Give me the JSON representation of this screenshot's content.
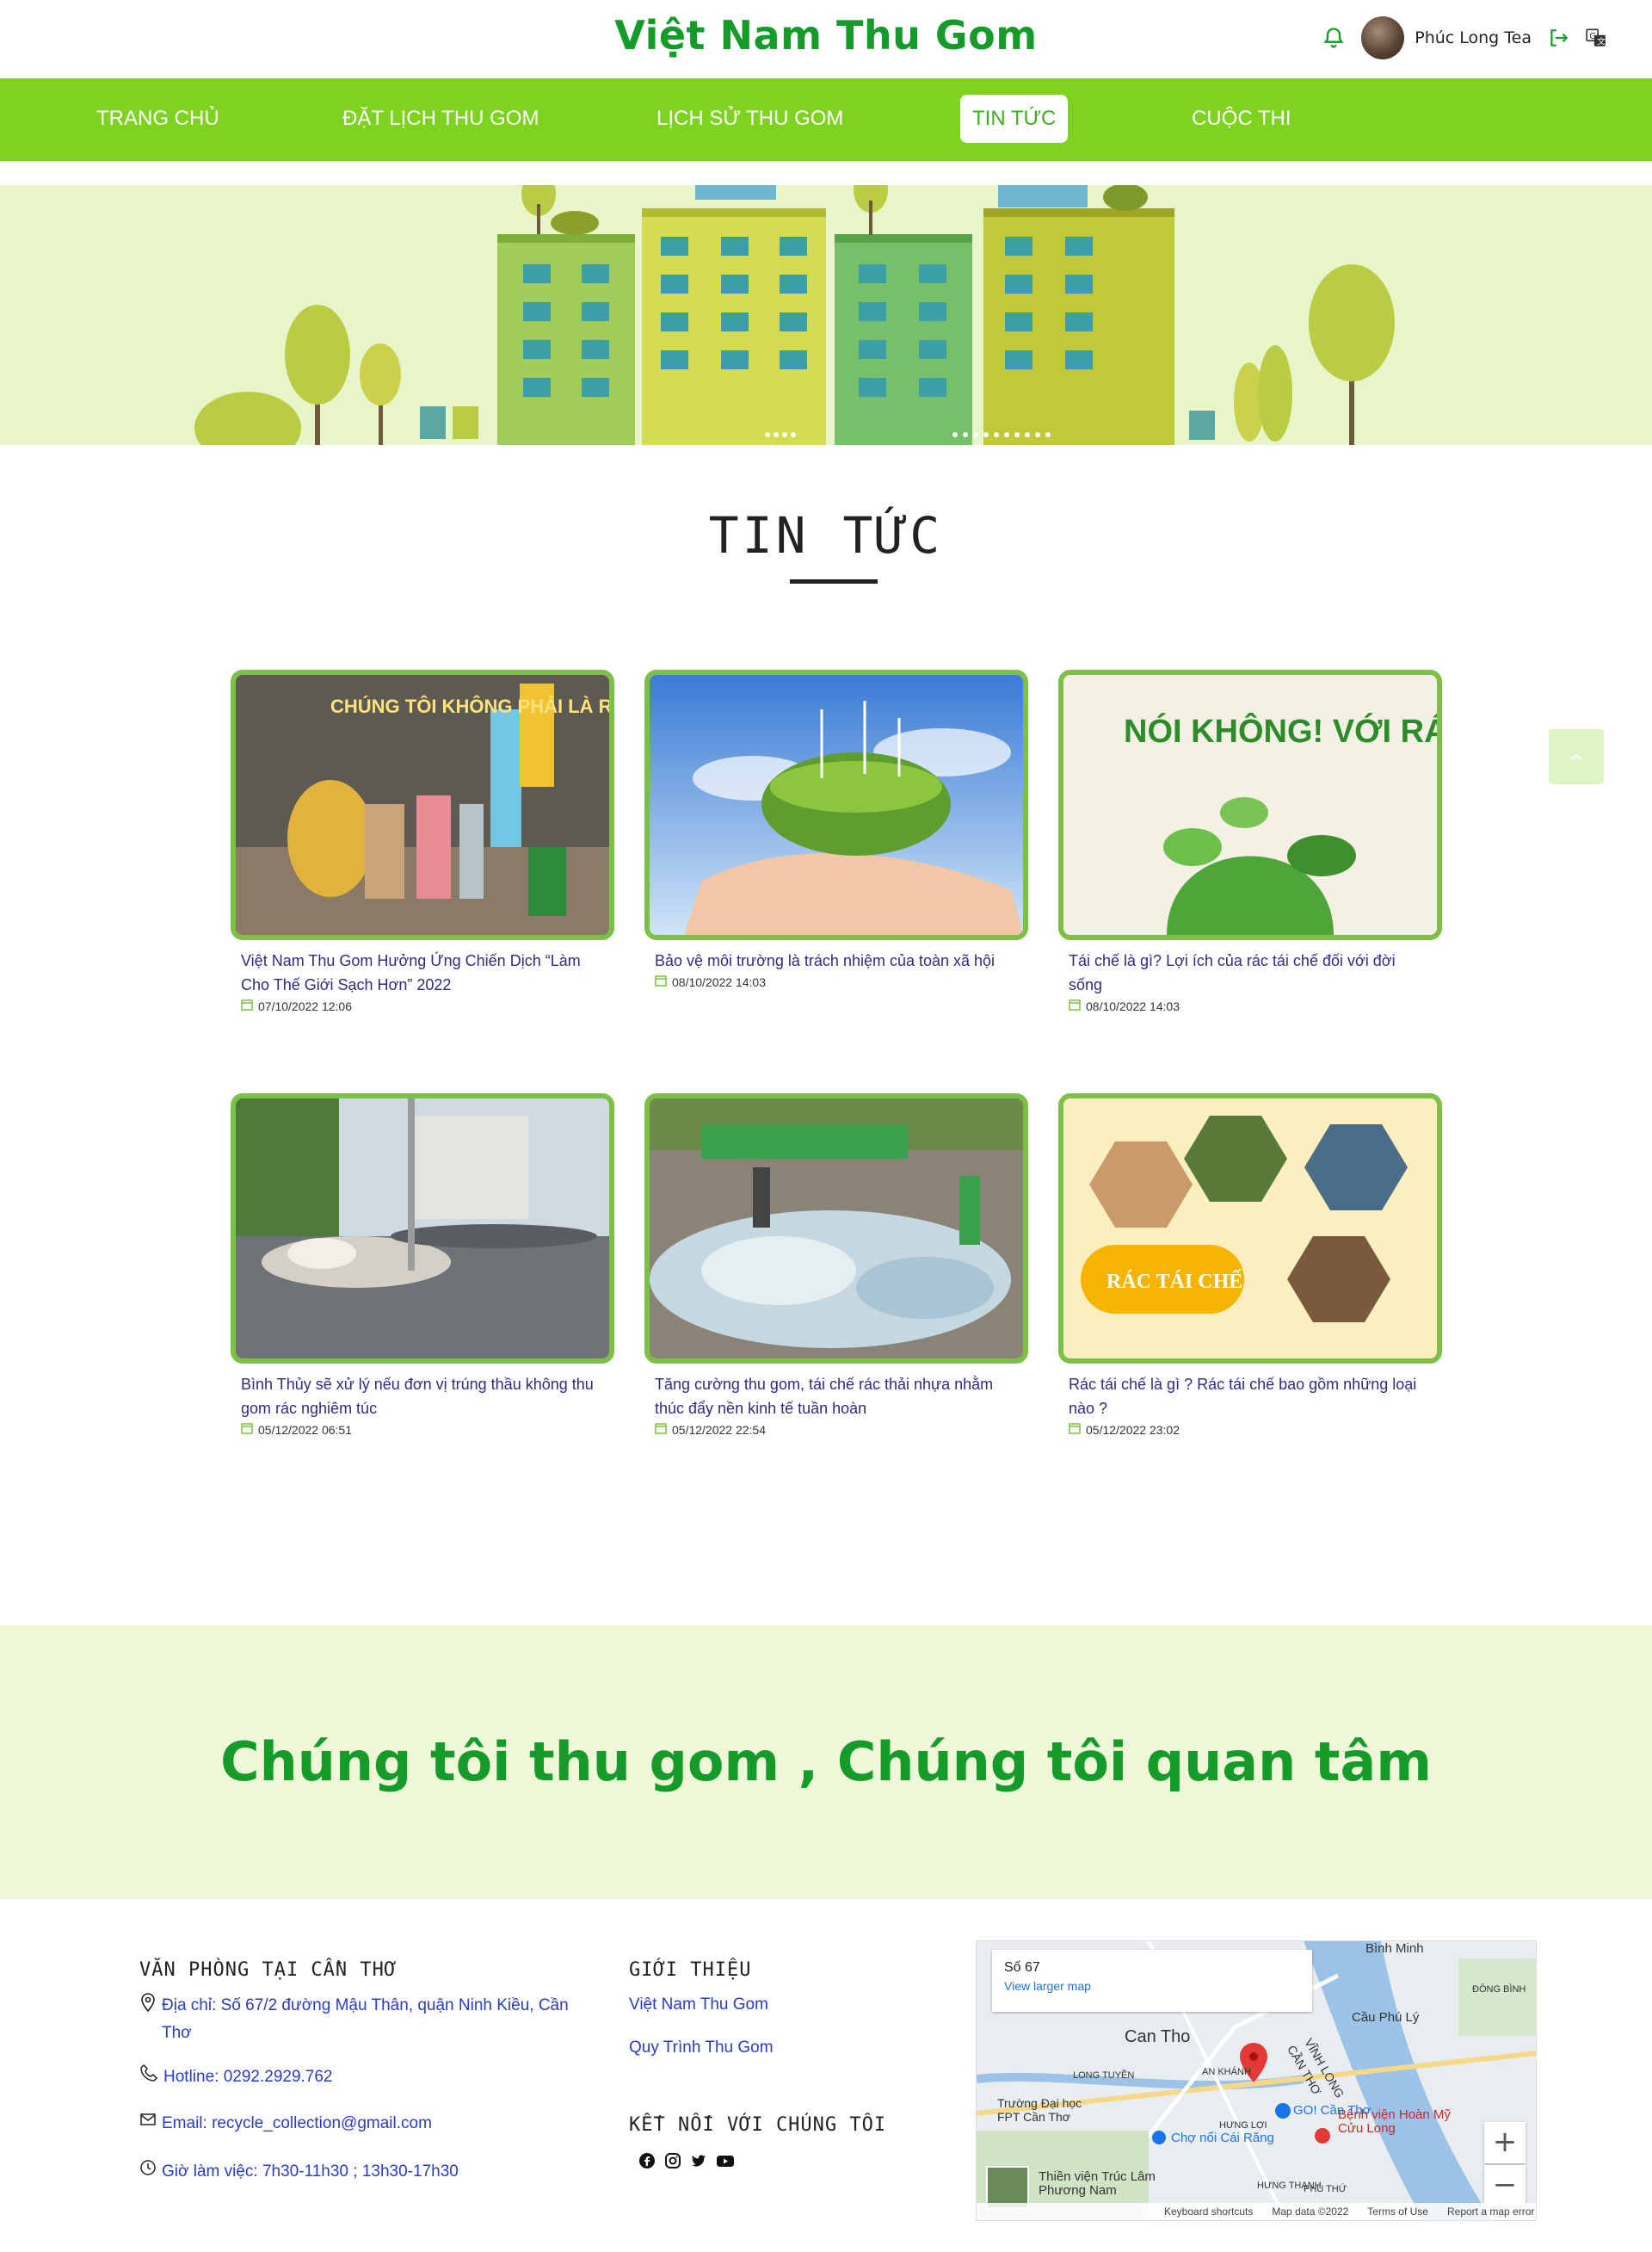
{
  "header": {
    "brand": "Việt Nam Thu Gom",
    "username": "Phúc Long Tea"
  },
  "nav": {
    "items": [
      {
        "label": "TRANG CHỦ",
        "active": false
      },
      {
        "label": "ĐẶT LỊCH THU GOM",
        "active": false
      },
      {
        "label": "LỊCH SỬ THU GOM",
        "active": false
      },
      {
        "label": "TIN TỨC",
        "active": true
      },
      {
        "label": "CUỘC THI",
        "active": false
      }
    ]
  },
  "page": {
    "title": "TIN TỨC"
  },
  "news": [
    {
      "title": "Việt Nam Thu Gom Hưởng Ứng Chiến Dịch “Làm Cho Thế Giới Sạch Hơn” 2022",
      "date": "07/10/2022 12:06",
      "image_text": "CHÚNG TÔI KHÔNG PHẢI LÀ RÁC"
    },
    {
      "title": "Bảo vệ môi trường là trách nhiệm của toàn xã hội",
      "date": "08/10/2022 14:03",
      "image_text": ""
    },
    {
      "title": "Tái chế là gì? Lợi ích của rác tái chế đối với đời sống",
      "date": "08/10/2022 14:03",
      "image_text": "NÓI KHÔNG! VỚI RÁC THẢI NHỰA"
    },
    {
      "title": "Bình Thủy sẽ xử lý nếu đơn vị trúng thầu không thu gom rác nghiêm túc",
      "date": "05/12/2022 06:51",
      "image_text": ""
    },
    {
      "title": "Tăng cường thu gom, tái chế rác thải nhựa nhằm thúc đẩy nền kinh tế tuần hoàn",
      "date": "05/12/2022 22:54",
      "image_text": ""
    },
    {
      "title": "Rác tái chế là gì ? Rác tái chế bao gồm những loại nào ?",
      "date": "05/12/2022 23:02",
      "image_text": "RÁC TÁI CHẾ"
    }
  ],
  "slogan": "Chúng tôi thu gom , Chúng tôi quan tâm",
  "footer": {
    "office_heading": "VĂN PHÒNG TẠI CẦN THƠ",
    "address": "Địa chỉ: Số 67/2 đường Mậu Thân, quận Ninh Kiều, Cần Thơ",
    "hotline": "Hotline: 0292.2929.762",
    "email": "Email: recycle_collection@gmail.com",
    "hours": "Giờ làm việc: 7h30-11h30 ; 13h30-17h30",
    "intro_heading": "GIỚI THIỆU",
    "intro_links": [
      "Việt Nam Thu Gom",
      "Quy Trình Thu Gom"
    ],
    "connect_heading": "KẾT NỐI VỚI CHÚNG TÔI",
    "socials": [
      "facebook-icon",
      "instagram-icon",
      "twitter-icon",
      "youtube-icon"
    ]
  },
  "map": {
    "place": "Số 67",
    "view_larger": "View larger map",
    "labels": [
      "Can Tho",
      "Bình Minh",
      "Cầu Phú Lý",
      "Bệnh viện Hoàn Mỹ Cửu Long",
      "Chợ nổi Cái Răng",
      "GO! Cần Thơ",
      "Trường Đại học FPT Cần Thơ",
      "VĨNH LONG",
      "CẦN THƠ",
      "ĐÔNG BÌNH",
      "LONG TUYỀN",
      "AN KHÁNH",
      "HƯNG LỢI",
      "HƯNG THẠNH",
      "PHÚ THỨ",
      "Thiền viện Trúc Lâm Phương Nam"
    ],
    "footer_items": [
      "Keyboard shortcuts",
      "Map data ©2022",
      "Terms of Use",
      "Report a map error"
    ],
    "zoom_in": "+",
    "zoom_out": "−"
  },
  "colors": {
    "brand_green": "#149b2a",
    "nav_green": "#7ed321",
    "card_border": "#7cc146",
    "link_blue": "#2a3bcc"
  }
}
